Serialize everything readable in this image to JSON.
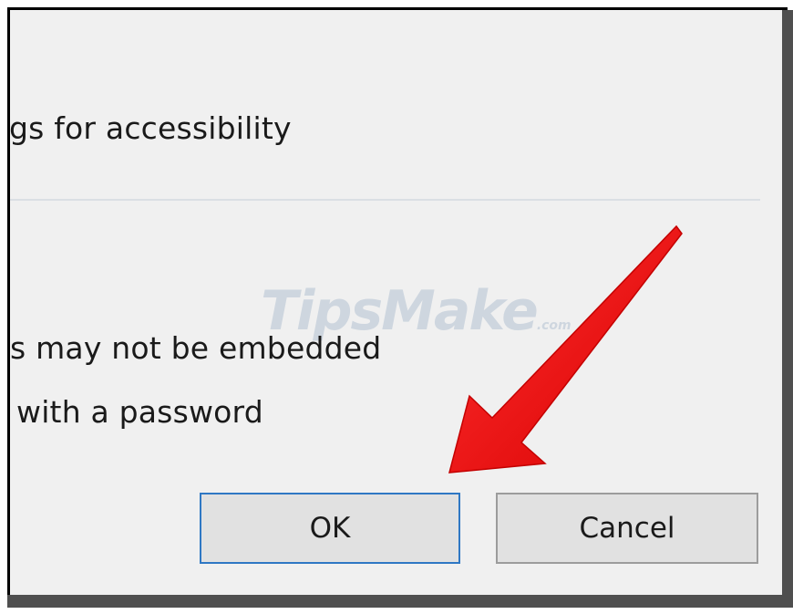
{
  "dialog": {
    "text_lines": [
      "gs for accessibility",
      "s may not be embedded",
      " with a password"
    ],
    "watermark": {
      "main": "TipsMake",
      "suffix": ".com"
    },
    "buttons": {
      "ok_label": "OK",
      "cancel_label": "Cancel"
    }
  },
  "annotation": {
    "arrow_color": "#ee1111",
    "points_to": "ok-button"
  },
  "colors": {
    "dialog_background": "#f0f0f0",
    "focused_button_border": "#2f78c4",
    "button_background": "#e1e1e1",
    "shadow": "#4f4f4f"
  }
}
